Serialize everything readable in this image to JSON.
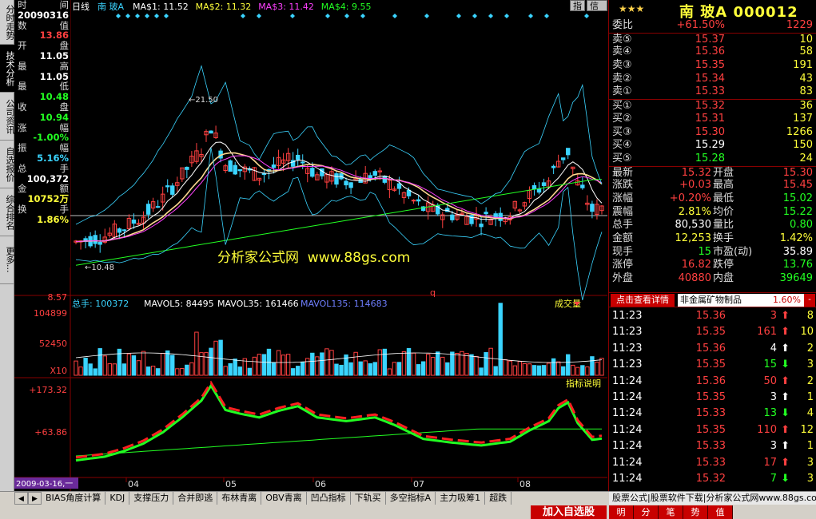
{
  "left_tabs": [
    "分时走势",
    "技术分析",
    "公司资讯",
    "自选报价",
    "综合排名",
    "更多..."
  ],
  "info_panel": [
    {
      "label": "时",
      "right": "间",
      "value": "20090316",
      "color": "white"
    },
    {
      "label": "数",
      "right": "值",
      "value": "13.86",
      "color": "red"
    },
    {
      "label": "开",
      "right": "盘",
      "value": "11.05",
      "color": "white"
    },
    {
      "label": "最",
      "right": "高",
      "value": "11.05",
      "color": "white"
    },
    {
      "label": "最",
      "right": "低",
      "value": "10.48",
      "color": "green"
    },
    {
      "label": "收",
      "right": "盘",
      "value": "10.94",
      "color": "green"
    },
    {
      "label": "涨",
      "right": "幅",
      "value": "-1.00%",
      "color": "green"
    },
    {
      "label": "振",
      "right": "幅",
      "value": "5.16%",
      "color": "cyan"
    },
    {
      "label": "总",
      "right": "手",
      "value": "100,372",
      "color": "white"
    },
    {
      "label": "金",
      "right": "额",
      "value": "10752万",
      "color": "yellow"
    },
    {
      "label": "换",
      "right": "手",
      "value": "1.86%",
      "color": "yellow"
    }
  ],
  "chart": {
    "period": "日线",
    "stock_name": "南 玻A",
    "ma_labels": [
      {
        "text": "MA$1: 11.52",
        "color": "#ffffff"
      },
      {
        "text": "MA$2: 11.32",
        "color": "#ffff3a"
      },
      {
        "text": "MA$3: 11.42",
        "color": "#ff40ff"
      },
      {
        "text": "MA$4: 9.55",
        "color": "#22ff22"
      }
    ],
    "price_axis": [
      "8.57"
    ],
    "high_marker": "21.50",
    "low_marker": "10.48",
    "volume_header": {
      "total": "总手: 100372",
      "mavol5": "MAVOL5: 84495",
      "mavol35": "MAVOL35: 161466",
      "mavol135": "MAVOL135: 114683"
    },
    "volume_axis": [
      "104899",
      "52450",
      "X10"
    ],
    "volume_label": "成交量",
    "indicator_axis": [
      "+173.32",
      "+63.86"
    ],
    "indicator_label": "指标说明",
    "x_axis_labels": [
      "04",
      "05",
      "06",
      "07",
      "08"
    ],
    "date_cursor": "2009-03-16,一",
    "q_marker": "q",
    "top_buttons": [
      "指",
      "信息"
    ]
  },
  "watermark": "分析家公式网  www.88gs.com",
  "quote": {
    "stars": "★★★",
    "title": "南 玻A 000012",
    "rows": [
      {
        "label": "委比",
        "value": "+61.50%",
        "vcolor": "red",
        "right": "1229",
        "rcolor": "red"
      },
      {
        "label": "卖⑤",
        "value": "15.37",
        "vcolor": "red",
        "right": "10",
        "rcolor": "yellow"
      },
      {
        "label": "卖④",
        "value": "15.36",
        "vcolor": "red",
        "right": "58",
        "rcolor": "yellow"
      },
      {
        "label": "卖③",
        "value": "15.35",
        "vcolor": "red",
        "right": "191",
        "rcolor": "yellow"
      },
      {
        "label": "卖②",
        "value": "15.34",
        "vcolor": "red",
        "right": "43",
        "rcolor": "yellow"
      },
      {
        "label": "卖①",
        "value": "15.33",
        "vcolor": "red",
        "right": "83",
        "rcolor": "yellow"
      },
      {
        "label": "买①",
        "value": "15.32",
        "vcolor": "red",
        "right": "36",
        "rcolor": "yellow"
      },
      {
        "label": "买②",
        "value": "15.31",
        "vcolor": "red",
        "right": "137",
        "rcolor": "yellow"
      },
      {
        "label": "买③",
        "value": "15.30",
        "vcolor": "red",
        "right": "1266",
        "rcolor": "yellow"
      },
      {
        "label": "买④",
        "value": "15.29",
        "vcolor": "white",
        "right": "150",
        "rcolor": "yellow"
      },
      {
        "label": "买⑤",
        "value": "15.28",
        "vcolor": "green",
        "right": "24",
        "rcolor": "yellow"
      }
    ],
    "stats": [
      {
        "l1": "最新",
        "v1": "15.32",
        "c1": "red",
        "l2": "开盘",
        "v2": "15.30",
        "c2": "red"
      },
      {
        "l1": "涨跌",
        "v1": "+0.03",
        "c1": "red",
        "l2": "最高",
        "v2": "15.45",
        "c2": "red"
      },
      {
        "l1": "涨幅",
        "v1": "+0.20%",
        "c1": "red",
        "l2": "最低",
        "v2": "15.02",
        "c2": "green"
      },
      {
        "l1": "震幅",
        "v1": "2.81%",
        "c1": "yellow",
        "l2": "均价",
        "v2": "15.22",
        "c2": "green"
      },
      {
        "l1": "总手",
        "v1": "80,530",
        "c1": "white",
        "l2": "量比",
        "v2": "0.80",
        "c2": "green"
      },
      {
        "l1": "金额",
        "v1": "12,253",
        "c1": "yellow",
        "l2": "换手",
        "v2": "1.42%",
        "c2": "yellow"
      },
      {
        "l1": "现手",
        "v1": "15",
        "c1": "green",
        "l2": "市盈(动)",
        "v2": "35.89",
        "c2": "white"
      },
      {
        "l1": "涨停",
        "v1": "16.82",
        "c1": "red",
        "l2": "跌停",
        "v2": "13.76",
        "c2": "green"
      },
      {
        "l1": "外盘",
        "v1": "40880",
        "c1": "red",
        "l2": "内盘",
        "v2": "39649",
        "c2": "green"
      }
    ]
  },
  "detail": {
    "button": "点击查看详情",
    "category": "非金属矿物制品",
    "pct": "1.60%",
    "dropdown": "-"
  },
  "ticks": [
    {
      "time": "11:23",
      "price": "15.36",
      "pcolor": "red",
      "vol": "3",
      "dir": "up",
      "n": "8"
    },
    {
      "time": "11:23",
      "price": "15.35",
      "pcolor": "red",
      "vol": "161",
      "dir": "up",
      "n": "10"
    },
    {
      "time": "11:23",
      "price": "15.36",
      "pcolor": "red",
      "vol": "4",
      "dir": "up-white",
      "n": "2"
    },
    {
      "time": "11:23",
      "price": "15.35",
      "pcolor": "red",
      "vol": "15",
      "dir": "down",
      "n": "3"
    },
    {
      "time": "11:24",
      "price": "15.36",
      "pcolor": "red",
      "vol": "50",
      "dir": "up",
      "n": "2"
    },
    {
      "time": "11:24",
      "price": "15.35",
      "pcolor": "red",
      "vol": "3",
      "dir": "up-white",
      "n": "1"
    },
    {
      "time": "11:24",
      "price": "15.33",
      "pcolor": "red",
      "vol": "13",
      "dir": "down",
      "n": "4"
    },
    {
      "time": "11:24",
      "price": "15.35",
      "pcolor": "red",
      "vol": "110",
      "dir": "up",
      "n": "12"
    },
    {
      "time": "11:24",
      "price": "15.33",
      "pcolor": "red",
      "vol": "3",
      "dir": "up-white",
      "n": "1"
    },
    {
      "time": "11:24",
      "price": "15.33",
      "pcolor": "red",
      "vol": "17",
      "dir": "up",
      "n": "3"
    },
    {
      "time": "11:24",
      "price": "15.32",
      "pcolor": "red",
      "vol": "7",
      "dir": "down",
      "n": "3"
    }
  ],
  "bottom_tabs": [
    "BIAS角度计算",
    "KDJ",
    "支撑压力",
    "合并即逃",
    "布林青离",
    "OBV青离",
    "凹凸指标",
    "下轨买",
    "多空指标A",
    "主力吸筹1",
    "超跌"
  ],
  "promo": "股票公式|股票软件下载|分析家公式网www.88gs.com",
  "add_button": "加入自选股",
  "bottom_small": [
    "明",
    "分",
    "笔",
    "势",
    "值"
  ],
  "colors": {
    "up": "#ff4040",
    "down": "#22ff22",
    "ma1": "#ffffff",
    "ma2": "#ffd890",
    "ma4": "#22ff22",
    "boll": "#3ad4ff",
    "accent": "#c80000"
  }
}
